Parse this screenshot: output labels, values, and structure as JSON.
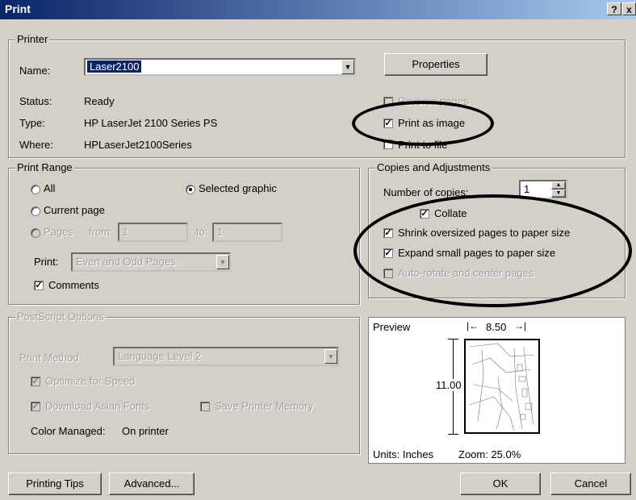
{
  "window": {
    "title": "Print",
    "help_icon": "?",
    "close_icon": "x"
  },
  "printer": {
    "legend": "Printer",
    "name_label": "Name:",
    "name_value": "Laser2100",
    "properties_label": "Properties",
    "status_label": "Status:",
    "status_value": "Ready",
    "type_label": "Type:",
    "type_value": "HP LaserJet 2100 Series PS",
    "where_label": "Where:",
    "where_value": "HPLaserJet2100Series",
    "reverse_pages_label": "Reverse pages",
    "print_as_image_label": "Print as image",
    "print_to_file_label": "Print to file"
  },
  "print_range": {
    "legend": "Print Range",
    "all_label": "All",
    "selected_graphic_label": "Selected graphic",
    "current_page_label": "Current page",
    "pages_label": "Pages",
    "from_label": "from:",
    "from_value": "1",
    "to_label": "to:",
    "to_value": "1",
    "print_label": "Print:",
    "print_value": "Even and Odd Pages",
    "comments_label": "Comments"
  },
  "copies": {
    "legend": "Copies and Adjustments",
    "number_label": "Number of copies:",
    "number_value": "1",
    "collate_label": "Collate",
    "shrink_label": "Shrink oversized pages to paper size",
    "expand_label": "Expand small pages to paper size",
    "autorotate_label": "Auto-rotate and center pages"
  },
  "postscript": {
    "legend": "PostScript Options",
    "method_label": "Print Method:",
    "method_value": "Language Level 2",
    "optimize_label": "Optimize for Speed",
    "download_label": "Download Asian Fonts",
    "save_memory_label": "Save Printer Memory",
    "color_label": "Color Managed:",
    "color_value": "On printer"
  },
  "preview": {
    "label": "Preview",
    "width_value": "8.50",
    "height_value": "11.00",
    "units_text": "Units: Inches",
    "zoom_text": "Zoom: 25.0%"
  },
  "buttons": {
    "tips": "Printing Tips",
    "advanced": "Advanced...",
    "ok": "OK",
    "cancel": "Cancel"
  }
}
